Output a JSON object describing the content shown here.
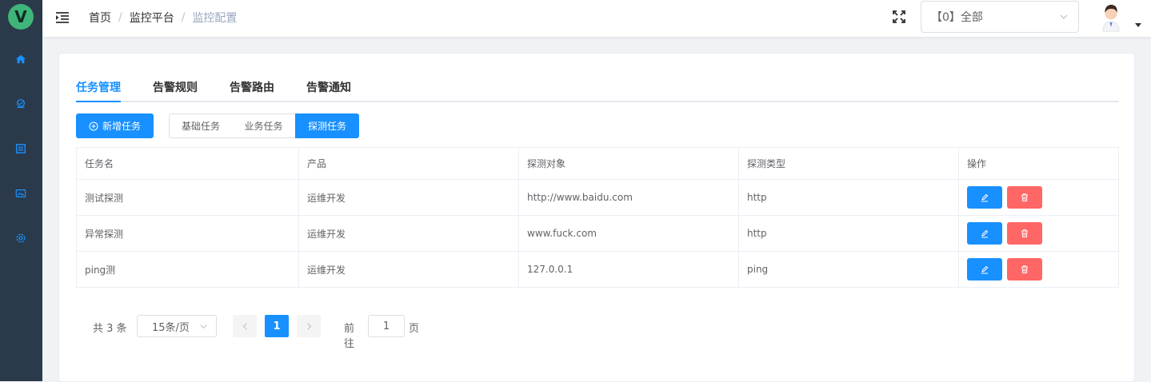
{
  "logo": {
    "letter": "V"
  },
  "sidebar": {
    "items": [
      {
        "icon": "home-icon",
        "color": "#1890ff"
      },
      {
        "icon": "monitor-icon",
        "color": "#1890ff"
      },
      {
        "icon": "grid-icon",
        "color": "#1890ff"
      },
      {
        "icon": "image-icon",
        "color": "#1890ff"
      },
      {
        "icon": "settings-icon",
        "color": "#1890ff"
      }
    ]
  },
  "header": {
    "breadcrumb": [
      "首页",
      "监控平台",
      "监控配置"
    ],
    "project_select": "【0】全部"
  },
  "tabs": [
    "任务管理",
    "告警规则",
    "告警路由",
    "告警通知"
  ],
  "toolbar": {
    "add_label": "新增任务",
    "segments": [
      "基础任务",
      "业务任务",
      "探测任务"
    ],
    "active_segment": "探测任务"
  },
  "table": {
    "headers": [
      "任务名",
      "产品",
      "探测对象",
      "探测类型",
      "操作"
    ],
    "rows": [
      [
        "测试探测",
        "运维开发",
        "http://www.baidu.com",
        "http"
      ],
      [
        "异常探测",
        "运维开发",
        "www.fuck.com",
        "http"
      ],
      [
        "ping测",
        "运维开发",
        "127.0.0.1",
        "ping"
      ]
    ]
  },
  "pagination": {
    "total": "共 3 条",
    "page_size": "15条/页",
    "current_page": "1",
    "goto_prefix": "前往",
    "goto_value": "1",
    "goto_suffix": "页"
  },
  "colors": {
    "primary": "#1890ff",
    "danger": "#ff6666",
    "sidebar": "#2b3a4a"
  }
}
